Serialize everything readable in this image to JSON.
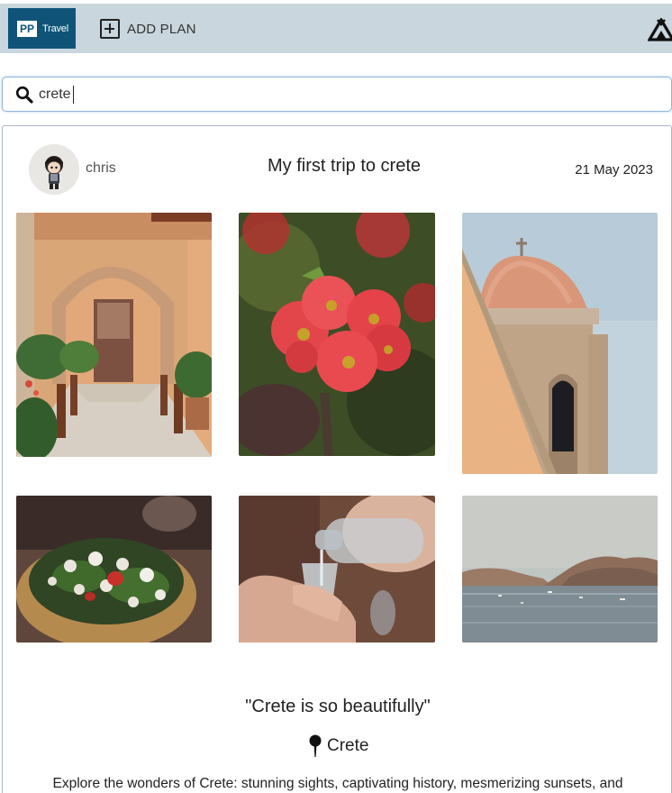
{
  "header": {
    "logo_mark": "PP",
    "logo_text": "Travel",
    "add_plan_label": "ADD PLAN",
    "brand_color": "#0f5478",
    "bar_color": "#c9d6de"
  },
  "search": {
    "value": "crete"
  },
  "post": {
    "username": "chris",
    "title": "My first trip to crete",
    "date": "21 May 2023",
    "quote": "\"Crete is so beautifully\"",
    "location": "Crete",
    "description": "Explore the wonders of Crete: stunning sights, captivating history, mesmerizing sunsets, and",
    "photos": [
      {
        "subject": "courtyard archway with potted plants"
      },
      {
        "subject": "red flowers close-up"
      },
      {
        "subject": "church dome against sky"
      },
      {
        "subject": "salad with feta in bowl"
      },
      {
        "subject": "pouring water into glass"
      },
      {
        "subject": "sea bay with boats at dusk"
      }
    ]
  },
  "icons": {
    "add_plan": "plus-square-icon",
    "account": "tent-icon",
    "search": "search-icon",
    "location": "map-pin-icon"
  }
}
